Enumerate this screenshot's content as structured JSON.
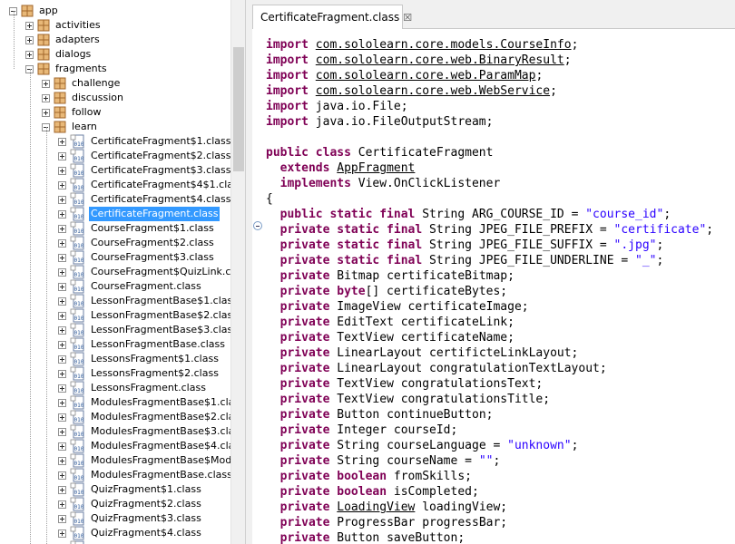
{
  "tree": {
    "selected_index": 15,
    "items": [
      {
        "label": "app",
        "depth": 0,
        "kind": "package",
        "expander": "minus"
      },
      {
        "label": "activities",
        "depth": 1,
        "kind": "package",
        "expander": "plus"
      },
      {
        "label": "adapters",
        "depth": 1,
        "kind": "package",
        "expander": "plus"
      },
      {
        "label": "dialogs",
        "depth": 1,
        "kind": "package",
        "expander": "plus"
      },
      {
        "label": "fragments",
        "depth": 1,
        "kind": "package",
        "expander": "minus"
      },
      {
        "label": "challenge",
        "depth": 2,
        "kind": "package",
        "expander": "plus"
      },
      {
        "label": "discussion",
        "depth": 2,
        "kind": "package",
        "expander": "plus"
      },
      {
        "label": "follow",
        "depth": 2,
        "kind": "package",
        "expander": "plus"
      },
      {
        "label": "learn",
        "depth": 2,
        "kind": "package",
        "expander": "minus"
      },
      {
        "label": "CertificateFragment$1.class",
        "depth": 3,
        "kind": "class",
        "expander": "plus"
      },
      {
        "label": "CertificateFragment$2.class",
        "depth": 3,
        "kind": "class",
        "expander": "plus"
      },
      {
        "label": "CertificateFragment$3.class",
        "depth": 3,
        "kind": "class",
        "expander": "plus"
      },
      {
        "label": "CertificateFragment$4$1.class",
        "depth": 3,
        "kind": "class",
        "expander": "plus"
      },
      {
        "label": "CertificateFragment$4.class",
        "depth": 3,
        "kind": "class",
        "expander": "plus"
      },
      {
        "label": "CertificateFragment.class",
        "depth": 3,
        "kind": "class",
        "expander": "plus"
      },
      {
        "label": "CourseFragment$1.class",
        "depth": 3,
        "kind": "class",
        "expander": "plus"
      },
      {
        "label": "CourseFragment$2.class",
        "depth": 3,
        "kind": "class",
        "expander": "plus"
      },
      {
        "label": "CourseFragment$3.class",
        "depth": 3,
        "kind": "class",
        "expander": "plus"
      },
      {
        "label": "CourseFragment$QuizLink.class",
        "depth": 3,
        "kind": "class",
        "expander": "plus"
      },
      {
        "label": "CourseFragment.class",
        "depth": 3,
        "kind": "class",
        "expander": "plus"
      },
      {
        "label": "LessonFragmentBase$1.class",
        "depth": 3,
        "kind": "class",
        "expander": "plus"
      },
      {
        "label": "LessonFragmentBase$2.class",
        "depth": 3,
        "kind": "class",
        "expander": "plus"
      },
      {
        "label": "LessonFragmentBase$3.class",
        "depth": 3,
        "kind": "class",
        "expander": "plus"
      },
      {
        "label": "LessonFragmentBase.class",
        "depth": 3,
        "kind": "class",
        "expander": "plus"
      },
      {
        "label": "LessonsFragment$1.class",
        "depth": 3,
        "kind": "class",
        "expander": "plus"
      },
      {
        "label": "LessonsFragment$2.class",
        "depth": 3,
        "kind": "class",
        "expander": "plus"
      },
      {
        "label": "LessonsFragment.class",
        "depth": 3,
        "kind": "class",
        "expander": "plus"
      },
      {
        "label": "ModulesFragmentBase$1.class",
        "depth": 3,
        "kind": "class",
        "expander": "plus"
      },
      {
        "label": "ModulesFragmentBase$2.class",
        "depth": 3,
        "kind": "class",
        "expander": "plus"
      },
      {
        "label": "ModulesFragmentBase$3.class",
        "depth": 3,
        "kind": "class",
        "expander": "plus"
      },
      {
        "label": "ModulesFragmentBase$4.class",
        "depth": 3,
        "kind": "class",
        "expander": "plus"
      },
      {
        "label": "ModulesFragmentBase$ModuleDeco",
        "depth": 3,
        "kind": "class",
        "expander": "plus"
      },
      {
        "label": "ModulesFragmentBase.class",
        "depth": 3,
        "kind": "class",
        "expander": "plus"
      },
      {
        "label": "QuizFragment$1.class",
        "depth": 3,
        "kind": "class",
        "expander": "plus"
      },
      {
        "label": "QuizFragment$2.class",
        "depth": 3,
        "kind": "class",
        "expander": "plus"
      },
      {
        "label": "QuizFragment$3.class",
        "depth": 3,
        "kind": "class",
        "expander": "plus"
      },
      {
        "label": "QuizFragment$4.class",
        "depth": 3,
        "kind": "class",
        "expander": "plus"
      },
      {
        "label": "",
        "depth": 3,
        "kind": "class",
        "expander": "plus"
      }
    ]
  },
  "icons": {
    "package": "package-icon",
    "class": "class-file-icon",
    "expand": "expand-plus-icon",
    "collapse": "collapse-minus-icon",
    "tab": "class-file-icon",
    "close": "close-icon",
    "fold": "fold-collapse-icon"
  },
  "editor": {
    "tab_title": "CertificateFragment.class",
    "tab_close": "☒",
    "code": [
      [
        [
          "kw",
          "import "
        ],
        [
          "u",
          "com.sololearn.core.models.CourseInfo"
        ],
        [
          "",
          "; "
        ]
      ],
      [
        [
          "kw",
          "import "
        ],
        [
          "u",
          "com.sololearn.core.web.BinaryResult"
        ],
        [
          "",
          ";"
        ]
      ],
      [
        [
          "kw",
          "import "
        ],
        [
          "u",
          "com.sololearn.core.web.ParamMap"
        ],
        [
          "",
          ";"
        ]
      ],
      [
        [
          "kw",
          "import "
        ],
        [
          "u",
          "com.sololearn.core.web.WebService"
        ],
        [
          "",
          ";"
        ]
      ],
      [
        [
          "kw",
          "import "
        ],
        [
          "",
          "java.io.File;"
        ]
      ],
      [
        [
          "kw",
          "import "
        ],
        [
          "",
          "java.io.FileOutputStream;"
        ]
      ],
      [],
      [
        [
          "kw",
          "public class "
        ],
        [
          "",
          "CertificateFragment"
        ]
      ],
      [
        [
          "",
          "  "
        ],
        [
          "kw",
          "extends "
        ],
        [
          "u",
          "AppFragment"
        ]
      ],
      [
        [
          "",
          "  "
        ],
        [
          "kw",
          "implements "
        ],
        [
          "",
          "View.OnClickListener"
        ]
      ],
      [
        [
          "",
          "{"
        ]
      ],
      [
        [
          "",
          "  "
        ],
        [
          "kw",
          "public static final "
        ],
        [
          "",
          "String ARG_COURSE_ID = "
        ],
        [
          "str",
          "\"course_id\""
        ],
        [
          "",
          ";"
        ]
      ],
      [
        [
          "",
          "  "
        ],
        [
          "kw",
          "private static final "
        ],
        [
          "",
          "String JPEG_FILE_PREFIX = "
        ],
        [
          "str",
          "\"certificate\""
        ],
        [
          "",
          ";"
        ]
      ],
      [
        [
          "",
          "  "
        ],
        [
          "kw",
          "private static final "
        ],
        [
          "",
          "String JPEG_FILE_SUFFIX = "
        ],
        [
          "str",
          "\".jpg\""
        ],
        [
          "",
          ";"
        ]
      ],
      [
        [
          "",
          "  "
        ],
        [
          "kw",
          "private static final "
        ],
        [
          "",
          "String JPEG_FILE_UNDERLINE = "
        ],
        [
          "str",
          "\"_\""
        ],
        [
          "",
          ";"
        ]
      ],
      [
        [
          "",
          "  "
        ],
        [
          "kw",
          "private "
        ],
        [
          "",
          "Bitmap certificateBitmap;"
        ]
      ],
      [
        [
          "",
          "  "
        ],
        [
          "kw",
          "private byte"
        ],
        [
          "",
          "[] certificateBytes;"
        ]
      ],
      [
        [
          "",
          "  "
        ],
        [
          "kw",
          "private "
        ],
        [
          "",
          "ImageView certificateImage;"
        ]
      ],
      [
        [
          "",
          "  "
        ],
        [
          "kw",
          "private "
        ],
        [
          "",
          "EditText certificateLink;"
        ]
      ],
      [
        [
          "",
          "  "
        ],
        [
          "kw",
          "private "
        ],
        [
          "",
          "TextView certificateName;"
        ]
      ],
      [
        [
          "",
          "  "
        ],
        [
          "kw",
          "private "
        ],
        [
          "",
          "LinearLayout certificteLinkLayout;"
        ]
      ],
      [
        [
          "",
          "  "
        ],
        [
          "kw",
          "private "
        ],
        [
          "",
          "LinearLayout congratulationTextLayout;"
        ]
      ],
      [
        [
          "",
          "  "
        ],
        [
          "kw",
          "private "
        ],
        [
          "",
          "TextView congratulationsText;"
        ]
      ],
      [
        [
          "",
          "  "
        ],
        [
          "kw",
          "private "
        ],
        [
          "",
          "TextView congratulationsTitle;"
        ]
      ],
      [
        [
          "",
          "  "
        ],
        [
          "kw",
          "private "
        ],
        [
          "",
          "Button continueButton;"
        ]
      ],
      [
        [
          "",
          "  "
        ],
        [
          "kw",
          "private "
        ],
        [
          "",
          "Integer courseId;"
        ]
      ],
      [
        [
          "",
          "  "
        ],
        [
          "kw",
          "private "
        ],
        [
          "",
          "String courseLanguage = "
        ],
        [
          "str",
          "\"unknown\""
        ],
        [
          "",
          ";"
        ]
      ],
      [
        [
          "",
          "  "
        ],
        [
          "kw",
          "private "
        ],
        [
          "",
          "String courseName = "
        ],
        [
          "str",
          "\"\""
        ],
        [
          "",
          ";"
        ]
      ],
      [
        [
          "",
          "  "
        ],
        [
          "kw",
          "private boolean "
        ],
        [
          "",
          "fromSkills;"
        ]
      ],
      [
        [
          "",
          "  "
        ],
        [
          "kw",
          "private boolean "
        ],
        [
          "",
          "isCompleted;"
        ]
      ],
      [
        [
          "",
          "  "
        ],
        [
          "kw",
          "private "
        ],
        [
          "u",
          "LoadingView"
        ],
        [
          "",
          " loadingView;"
        ]
      ],
      [
        [
          "",
          "  "
        ],
        [
          "kw",
          "private "
        ],
        [
          "",
          "ProgressBar progressBar;"
        ]
      ],
      [
        [
          "",
          "  "
        ],
        [
          "kw",
          "private "
        ],
        [
          "",
          "Button saveButton;"
        ]
      ]
    ]
  }
}
